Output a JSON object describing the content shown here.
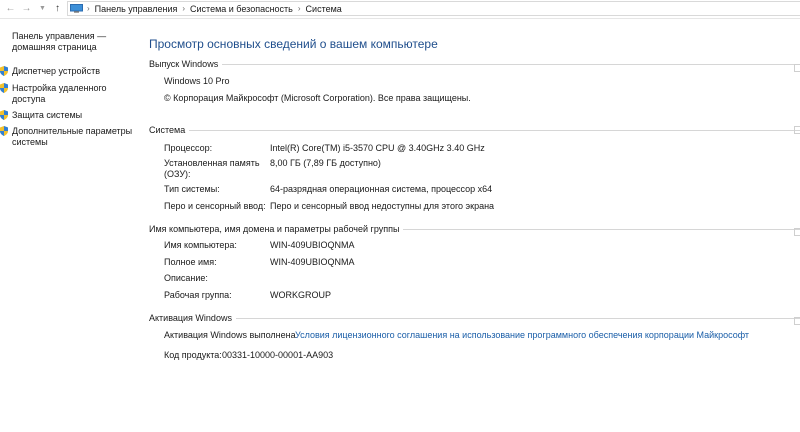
{
  "window": {
    "breadcrumbs": [
      "Панель управления",
      "Система и безопасность",
      "Система"
    ]
  },
  "icons": {
    "back": "arrow-left-icon",
    "forward": "arrow-right-icon",
    "history": "chevron-down-icon",
    "up": "arrow-up-icon",
    "location": "computer-icon"
  },
  "sidebar": {
    "home": "Панель управления — домашняя страница",
    "items": [
      {
        "label": "Диспетчер устройств"
      },
      {
        "label": "Настройка удаленного доступа"
      },
      {
        "label": "Защита системы"
      },
      {
        "label": "Дополнительные параметры системы"
      }
    ]
  },
  "main": {
    "title": "Просмотр основных сведений о вашем компьютере",
    "windows_edition": {
      "header": "Выпуск Windows",
      "edition": "Windows 10 Pro",
      "copyright": "© Корпорация Майкрософт (Microsoft Corporation). Все права защищены."
    },
    "system": {
      "header": "Система",
      "rows": [
        {
          "key": "Процессор:",
          "value": "Intel(R) Core(TM) i5-3570 CPU @ 3.40GHz   3.40 GHz"
        },
        {
          "key": "Установленная память (ОЗУ):",
          "value": "8,00 ГБ (7,89 ГБ доступно)"
        },
        {
          "key": "Тип системы:",
          "value": "64-разрядная операционная система, процессор x64"
        },
        {
          "key": "Перо и сенсорный ввод:",
          "value": "Перо и сенсорный ввод недоступны для этого экрана"
        }
      ]
    },
    "computer": {
      "header": "Имя компьютера, имя домена и параметры рабочей группы",
      "rows": [
        {
          "key": "Имя компьютера:",
          "value": "WIN-409UBIOQNMA"
        },
        {
          "key": "Полное имя:",
          "value": "WIN-409UBIOQNMA"
        },
        {
          "key": "Описание:",
          "value": ""
        },
        {
          "key": "Рабочая группа:",
          "value": "WORKGROUP"
        }
      ]
    },
    "activation": {
      "header": "Активация Windows",
      "status": "Активация Windows выполнена",
      "license_link": "Условия лицензионного соглашения на использование программного обеспечения корпорации Майкрософт",
      "product_id_label": "Код продукта:",
      "product_id": "00331-10000-00001-AA903"
    }
  },
  "colors": {
    "title": "#1f4e8c",
    "link": "#1a5ea8",
    "rule": "#d6d6d6"
  }
}
